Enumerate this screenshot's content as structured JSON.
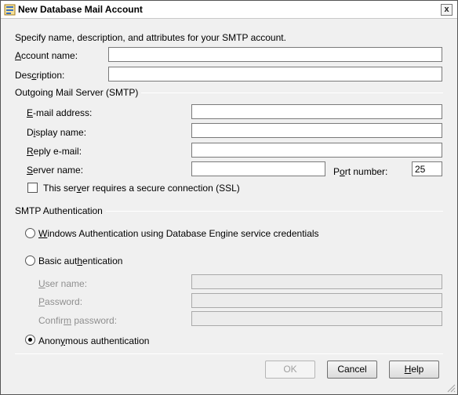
{
  "window": {
    "title": "New Database Mail Account",
    "close_glyph": "x"
  },
  "intro": "Specify name, description, and attributes for your SMTP account.",
  "account": {
    "name_label_u": "A",
    "name_label_rest": "ccount name:",
    "name_value": "",
    "desc_label_pre": "Des",
    "desc_label_u": "c",
    "desc_label_rest": "ription:",
    "desc_value": ""
  },
  "smtp": {
    "section_title": "Outgoing Mail Server (SMTP)",
    "email_u": "E",
    "email_rest": "-mail address:",
    "email_value": "",
    "display_pre": "D",
    "display_u": "i",
    "display_rest": "splay name:",
    "display_value": "",
    "reply_u": "R",
    "reply_rest": "eply e-mail:",
    "reply_value": "",
    "server_u": "S",
    "server_rest": "erver name:",
    "server_value": "",
    "port_pre": "P",
    "port_u": "o",
    "port_rest": "rt number:",
    "port_value": "25",
    "ssl_pre": "This ser",
    "ssl_u": "v",
    "ssl_rest": "er requires a secure connection (SSL)",
    "ssl_checked": false
  },
  "auth": {
    "section_title": "SMTP Authentication",
    "windows_u": "W",
    "windows_rest": "indows Authentication using Database Engine service credentials",
    "basic_pre": "Basic aut",
    "basic_u": "h",
    "basic_rest": "entication",
    "user_u": "U",
    "user_rest": "ser name:",
    "password_u": "P",
    "password_rest": "assword:",
    "confirm_pre": "Confir",
    "confirm_u": "m",
    "confirm_rest": " password:",
    "anon_pre": "Anon",
    "anon_u": "y",
    "anon_rest": "mous authentication",
    "selected": "anonymous"
  },
  "buttons": {
    "ok": "OK",
    "cancel": "Cancel",
    "help_u": "H",
    "help_rest": "elp"
  }
}
